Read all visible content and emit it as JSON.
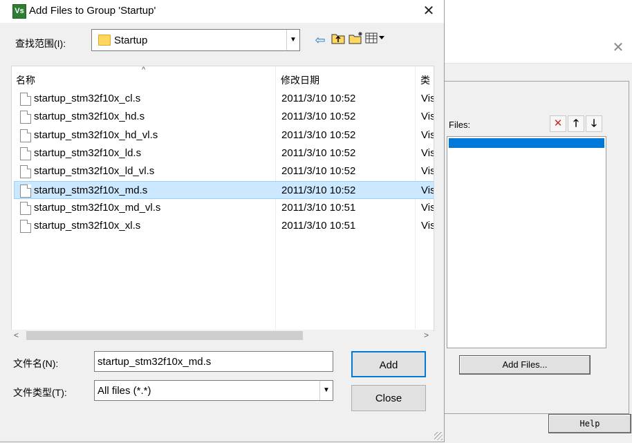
{
  "main_dialog": {
    "title": "Add Files to Group 'Startup'",
    "app_icon": "Vs",
    "close_glyph": "✕",
    "lookin_label": "查找范围(I):",
    "lookin_value": "Startup",
    "columns": {
      "name": "名称",
      "modified": "修改日期",
      "type": "类"
    },
    "files": [
      {
        "name": "startup_stm32f10x_cl.s",
        "modified": "2011/3/10 10:52",
        "type": "Vis"
      },
      {
        "name": "startup_stm32f10x_hd.s",
        "modified": "2011/3/10 10:52",
        "type": "Vis"
      },
      {
        "name": "startup_stm32f10x_hd_vl.s",
        "modified": "2011/3/10 10:52",
        "type": "Vis"
      },
      {
        "name": "startup_stm32f10x_ld.s",
        "modified": "2011/3/10 10:52",
        "type": "Vis"
      },
      {
        "name": "startup_stm32f10x_ld_vl.s",
        "modified": "2011/3/10 10:52",
        "type": "Vis"
      },
      {
        "name": "startup_stm32f10x_md.s",
        "modified": "2011/3/10 10:52",
        "type": "Vis"
      },
      {
        "name": "startup_stm32f10x_md_vl.s",
        "modified": "2011/3/10 10:51",
        "type": "Vis"
      },
      {
        "name": "startup_stm32f10x_xl.s",
        "modified": "2011/3/10 10:51",
        "type": "Vis"
      }
    ],
    "selected_file_index": 5,
    "filename_label": "文件名(N):",
    "filename_value": "startup_stm32f10x_md.s",
    "filetype_label": "文件类型(T):",
    "filetype_value": "All files (*.*)",
    "add_button": "Add",
    "close_button": "Close"
  },
  "background_dialog": {
    "files_label": "Files:",
    "add_files_button": "Add Files...",
    "help_button": "Help",
    "close_glyph": "✕"
  },
  "icons": {
    "back": "back-arrow-icon",
    "up": "up-folder-icon",
    "new_folder": "new-folder-icon",
    "view_menu": "view-menu-icon",
    "delete": "delete-x-icon",
    "move_up": "move-up-icon",
    "move_down": "move-down-icon"
  },
  "colors": {
    "selection": "#cce8ff",
    "accent": "#0078d7",
    "folder": "#ffd761",
    "app_icon": "#2e7d32",
    "delete_icon": "#c62828"
  }
}
